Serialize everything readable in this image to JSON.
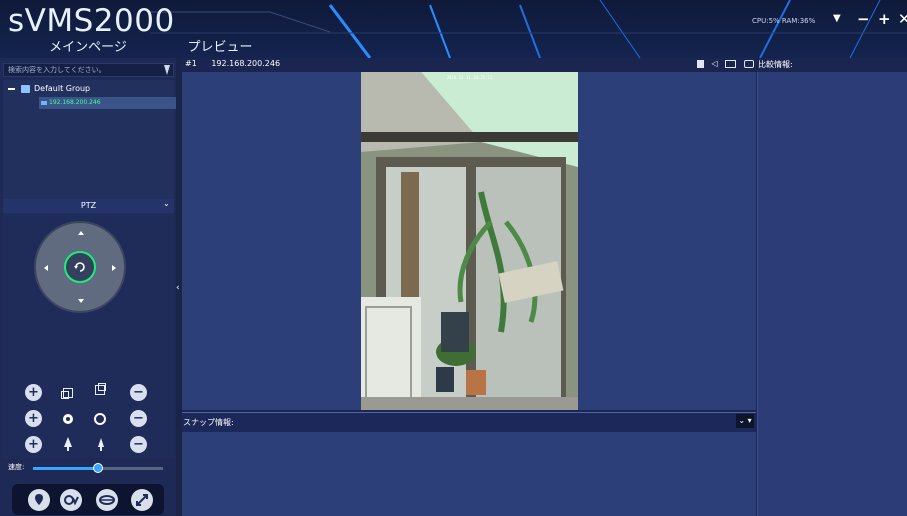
{
  "header": {
    "brand": "sVMS2000",
    "nav": [
      "メインページ",
      "プレビュー"
    ],
    "sysinfo": "CPU:5%  RAM:36%",
    "window_buttons": [
      "▼",
      "−",
      "+",
      "✕"
    ]
  },
  "left": {
    "search_placeholder": "検索内容を入力してください。",
    "tree": {
      "root_label": "Default Group",
      "device_label": "192.168.200.246"
    },
    "ptz": {
      "title": "PTZ",
      "speed_label": "速度:",
      "speed_value": 0.5
    }
  },
  "video": {
    "channel": "#1",
    "ip": "192.168.200.246",
    "timestamp": "2016 12 11 10:25:51",
    "toolbar_icons": [
      "record-icon",
      "audio-icon",
      "talk-icon",
      "snapshot-icon",
      "close-icon"
    ]
  },
  "snapshot": {
    "label": "スナップ情報:"
  },
  "compare": {
    "label": "比較情報:"
  },
  "colors": {
    "accent": "#39a6ff",
    "selected_device": "#40ff9a",
    "joystick_ring": "#18f07a"
  }
}
